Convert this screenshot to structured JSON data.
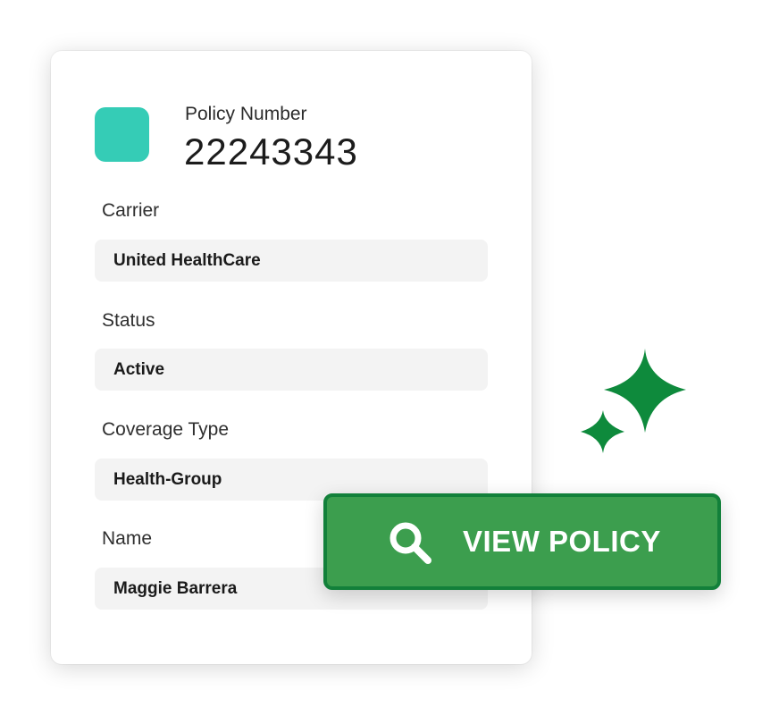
{
  "policy": {
    "label": "Policy Number",
    "number": "22243343",
    "badge_color": "#35ccb6"
  },
  "fields": [
    {
      "label": "Carrier",
      "value": "United HealthCare"
    },
    {
      "label": "Status",
      "value": "Active"
    },
    {
      "label": "Coverage Type",
      "value": "Health-Group"
    },
    {
      "label": "Name",
      "value": "Maggie Barrera"
    }
  ],
  "view_button": {
    "label": "VIEW POLICY",
    "icon": "search-icon",
    "background": "#3c9e4e",
    "border": "#12803a"
  },
  "decoration": {
    "icon": "sparkles-icon",
    "color": "#0e8a3c"
  }
}
